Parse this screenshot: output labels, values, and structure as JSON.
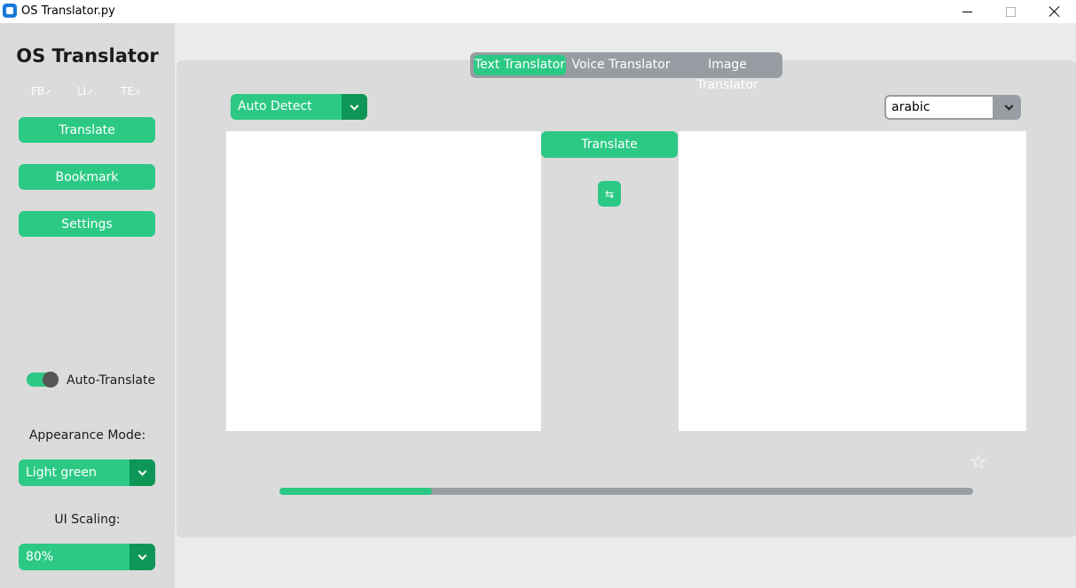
{
  "window": {
    "title": "OS Translator.py"
  },
  "sidebar": {
    "logo": "OS Translator",
    "social": [
      {
        "label": "FB",
        "arrow": "↗"
      },
      {
        "label": "LI",
        "arrow": "↗"
      },
      {
        "label": "TE",
        "arrow": "↗"
      }
    ],
    "nav": [
      {
        "label": "Translate"
      },
      {
        "label": "Bookmark"
      },
      {
        "label": "Settings"
      }
    ],
    "auto_translate": {
      "label": "Auto-Translate",
      "on": true
    },
    "appearance": {
      "label": "Appearance Mode:",
      "value": "Light green"
    },
    "scaling": {
      "label": "UI Scaling:",
      "value": "80%"
    }
  },
  "tabs": [
    {
      "label": "Text Translator",
      "active": true
    },
    {
      "label": "Voice Translator",
      "active": false
    },
    {
      "label": "Image Translator",
      "active": false
    }
  ],
  "source_lang": {
    "value": "Auto Detect"
  },
  "target_lang": {
    "value": "arabic"
  },
  "translate_button": "Translate",
  "swap_button": "⇆",
  "bookmark_star": "☆",
  "progress": {
    "value": 0.22
  },
  "colors": {
    "accent": "#2cc985",
    "accent_dark": "#0e9657",
    "neutral": "#979da2",
    "panel": "#dbdbdb",
    "window_bg": "#ebebeb"
  },
  "icons": {
    "app": "app-icon",
    "minimize": "minimize-icon",
    "maximize": "maximize-icon",
    "close": "close-icon",
    "swap": "swap-icon",
    "star": "star-icon",
    "chevron": "chevron-down-icon"
  }
}
